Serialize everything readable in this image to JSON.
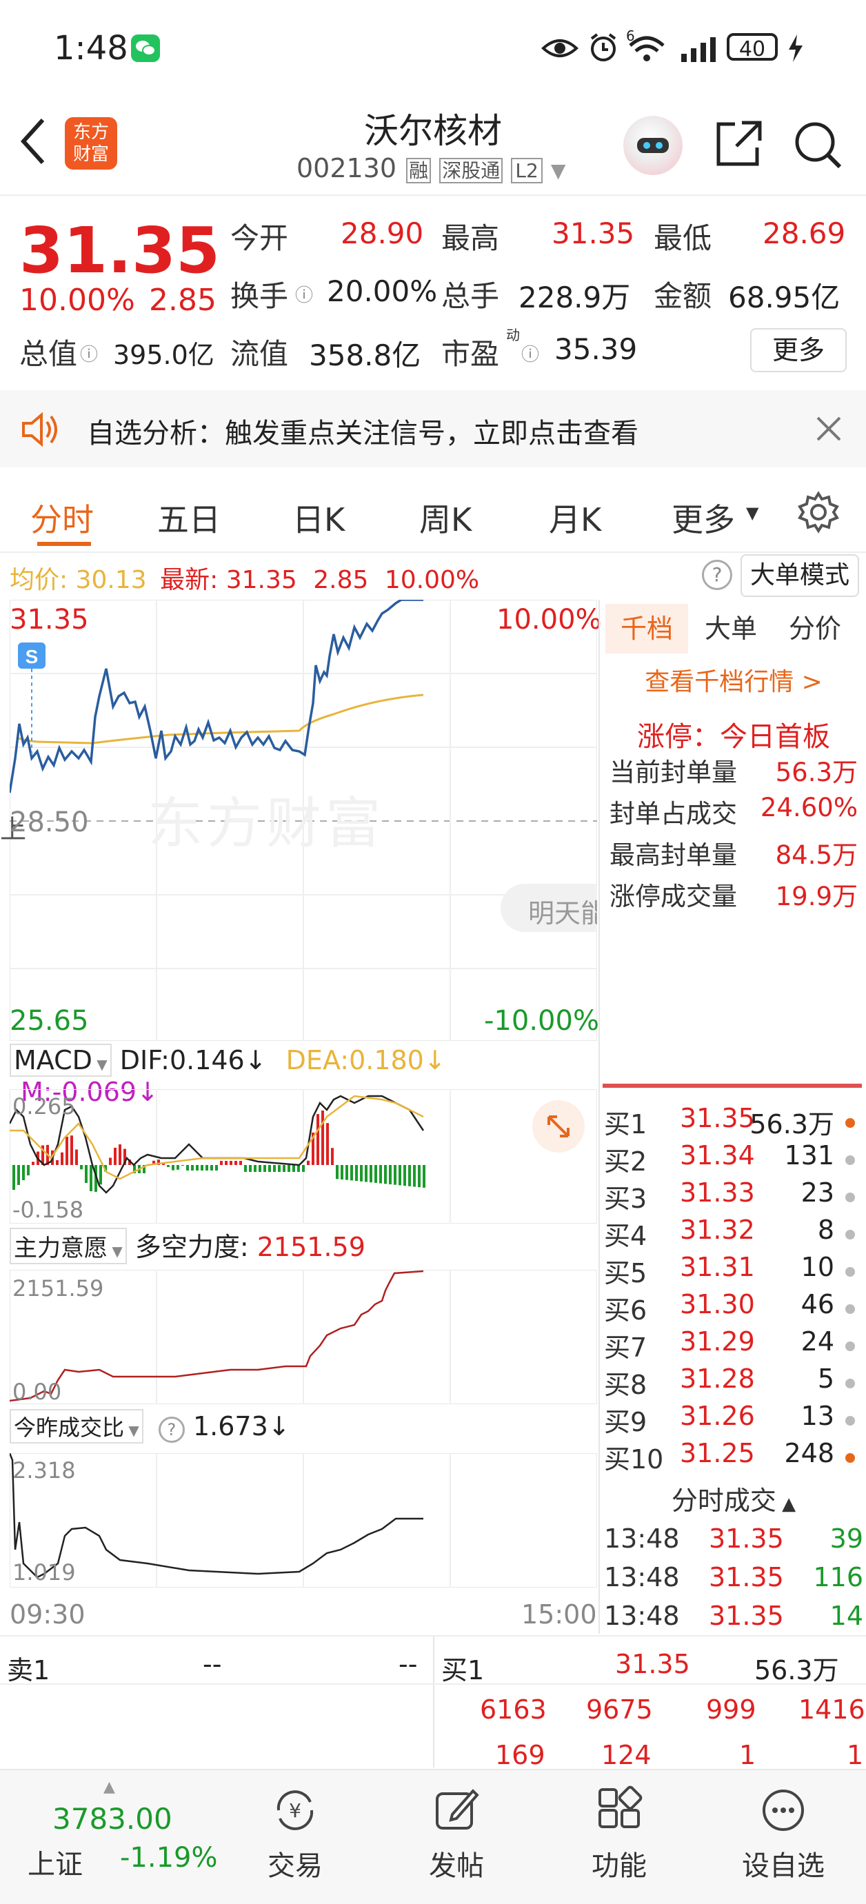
{
  "status_bar": {
    "time": "1:48",
    "signal": "6",
    "battery": "40"
  },
  "header": {
    "logo_text_1": "东方",
    "logo_text_2": "财富",
    "stock_name": "沃尔核材",
    "stock_code": "002130",
    "tags": [
      "融",
      "深股通",
      "L2"
    ]
  },
  "quote": {
    "price": "31.35",
    "change_pct": "10.00%",
    "change": "2.85",
    "open_label": "今开",
    "open": "28.90",
    "high_label": "最高",
    "high": "31.35",
    "low_label": "最低",
    "low": "28.69",
    "turnover_label": "换手",
    "turnover": "20.00%",
    "vol_label": "总手",
    "vol": "228.9万",
    "amount_label": "金额",
    "amount": "68.95亿",
    "mcap_label": "总值",
    "mcap": "395.0亿",
    "float_label": "流值",
    "float_cap": "358.8亿",
    "pe_label": "市盈",
    "pe_sup": "动",
    "pe": "35.39",
    "more_button": "更多"
  },
  "notice": {
    "text": "自选分析：触发重点关注信号，立即点击查看"
  },
  "tabs": [
    "分时",
    "五日",
    "日K",
    "周K",
    "月K",
    "更多"
  ],
  "info_line": {
    "avg_label": "均价:",
    "avg": "30.13",
    "latest_label": "最新:",
    "latest": "31.35",
    "change": "2.85",
    "pct": "10.00%",
    "mode_button": "大单模式"
  },
  "chart_labels": {
    "top_price": "31.35",
    "top_pct": "10.00%",
    "mid_price": "28.50",
    "bottom_price": "25.65",
    "bottom_pct": "-10.00%",
    "watermark": "东方财富",
    "tomorrow_hint": "明天能",
    "s_marker": "S",
    "mid_left_tag": "上"
  },
  "macd": {
    "name": "MACD",
    "dif": "DIF:0.146↓",
    "dea": "DEA:0.180↓",
    "m": "M:-0.069↓",
    "max": "0.265",
    "min": "-0.158"
  },
  "main_force": {
    "name": "主力意愿",
    "label": "多空力度:",
    "value": "2151.59",
    "max": "2151.59",
    "min": "0.00"
  },
  "vol_ratio": {
    "name": "今昨成交比",
    "value": "1.673↓",
    "max": "2.318",
    "min": "1.019"
  },
  "time_axis": {
    "start": "09:30",
    "end": "15:00"
  },
  "side_panel": {
    "tabs": [
      "千档",
      "大单",
      "分价"
    ],
    "link": "查看千档行情 >",
    "limit_up": "涨停：今日首板",
    "seal_stats": [
      {
        "k": "当前封单量",
        "v": "56.3万"
      },
      {
        "k": "封单占成交",
        "v": "24.60%"
      },
      {
        "k": "最高封单量",
        "v": "84.5万"
      },
      {
        "k": "涨停成交量",
        "v": "19.9万"
      }
    ],
    "bids": [
      {
        "label": "买1",
        "price": "31.35",
        "vol": "56.3万",
        "dot": "#e8661a"
      },
      {
        "label": "买2",
        "price": "31.34",
        "vol": "131",
        "dot": "#bbbbbb"
      },
      {
        "label": "买3",
        "price": "31.33",
        "vol": "23",
        "dot": "#bbbbbb"
      },
      {
        "label": "买4",
        "price": "31.32",
        "vol": "8",
        "dot": "#bbbbbb"
      },
      {
        "label": "买5",
        "price": "31.31",
        "vol": "10",
        "dot": "#bbbbbb"
      },
      {
        "label": "买6",
        "price": "31.30",
        "vol": "46",
        "dot": "#bbbbbb"
      },
      {
        "label": "买7",
        "price": "31.29",
        "vol": "24",
        "dot": "#bbbbbb"
      },
      {
        "label": "买8",
        "price": "31.28",
        "vol": "5",
        "dot": "#bbbbbb"
      },
      {
        "label": "买9",
        "price": "31.26",
        "vol": "13",
        "dot": "#bbbbbb"
      },
      {
        "label": "买10",
        "price": "31.25",
        "vol": "248",
        "dot": "#e8661a"
      }
    ],
    "trades_title": "分时成交",
    "trades": [
      {
        "time": "13:48",
        "price": "31.35",
        "vol": "39"
      },
      {
        "time": "13:48",
        "price": "31.35",
        "vol": "116"
      },
      {
        "time": "13:48",
        "price": "31.35",
        "vol": "14"
      }
    ]
  },
  "bottom_book": {
    "sell_label": "卖1",
    "sell_price": "--",
    "sell_vol": "--",
    "buy_label": "买1",
    "buy_price": "31.35",
    "buy_vol": "56.3万",
    "queue_row1": [
      "6163",
      "9675",
      "999",
      "1416"
    ],
    "queue_row2": [
      "169",
      "124",
      "1",
      "1"
    ]
  },
  "bottom_nav": {
    "index_value": "3783.00",
    "index_name": "上证",
    "index_pct": "-1.19%",
    "items": [
      "交易",
      "发帖",
      "功能",
      "设自选"
    ]
  },
  "colors": {
    "up": "#e02020",
    "down": "#1a9a2a",
    "accent": "#e8661a",
    "price_line": "#2a5d9f",
    "avg_line": "#e8b43a"
  }
}
